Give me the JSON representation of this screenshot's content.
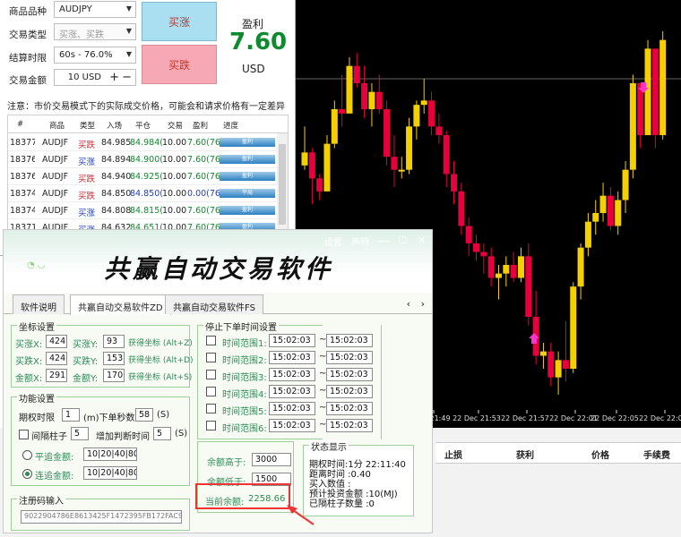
{
  "trade_panel": {
    "symbol_label": "商品品种",
    "symbol_value": "AUDJPY",
    "type_label": "交易类型",
    "type_value": "买涨、买跌",
    "expiry_label": "结算时限",
    "expiry_value": "60s - 76.0%",
    "amount_label": "交易金额",
    "amount_value": "10 USD",
    "buy_up_label": "买涨",
    "buy_down_label": "买跌",
    "profit_label": "盈利",
    "profit_value": "7.60",
    "profit_unit": "USD",
    "notice": "注意：市价交易模式下的实际成交价格，可能会和请求价格有一定差异",
    "table_headers": [
      "#",
      "商品",
      "类型",
      "入场",
      "平仓",
      "交易",
      "盈利",
      "进度"
    ],
    "rows": [
      {
        "id": "18377",
        "sym": "AUDJF",
        "type": "买跌",
        "entry": "84.985",
        "close": "84.984(",
        "amt": "10.00",
        "profit": "7.60(76",
        "state": "盈利",
        "type_color": "#d0262f",
        "close_color": "#0e8a2f",
        "profit_color": "#0e8a2f"
      },
      {
        "id": "18376",
        "sym": "AUDJF",
        "type": "买涨",
        "entry": "84.894",
        "close": "84.900(",
        "amt": "10.00",
        "profit": "7.60(76",
        "state": "盈利",
        "type_color": "#1f3fbf",
        "close_color": "#0e8a2f",
        "profit_color": "#0e8a2f"
      },
      {
        "id": "18376",
        "sym": "AUDJF",
        "type": "买跌",
        "entry": "84.940",
        "close": "84.925(",
        "amt": "10.00",
        "profit": "7.60(76",
        "state": "盈利",
        "type_color": "#d0262f",
        "close_color": "#0e8a2f",
        "profit_color": "#0e8a2f"
      },
      {
        "id": "18374",
        "sym": "AUDJF",
        "type": "买跌",
        "entry": "84.850",
        "close": "84.850(",
        "amt": "10.00",
        "profit": "0.00(76",
        "state": "平局",
        "type_color": "#d0262f",
        "close_color": "#1f3fbf",
        "profit_color": "#1f3fbf"
      },
      {
        "id": "18374",
        "sym": "AUDJF",
        "type": "买涨",
        "entry": "84.808",
        "close": "84.815(",
        "amt": "10.00",
        "profit": "7.60(76",
        "state": "盈利",
        "type_color": "#1f3fbf",
        "close_color": "#0e8a2f",
        "profit_color": "#0e8a2f"
      },
      {
        "id": "18371",
        "sym": "AUDJF",
        "type": "买涨",
        "entry": "84.632",
        "close": "84.651(",
        "amt": "10.00",
        "profit": "7.60(76",
        "state": "盈利",
        "type_color": "#1f3fbf",
        "close_color": "#0e8a2f",
        "profit_color": "#0e8a2f"
      },
      {
        "id": "18370",
        "sym": "AUDJF",
        "type": "买涨",
        "entry": "84.666",
        "close": "84.687(",
        "amt": "20.00",
        "profit": "15.20(7",
        "state": "盈利",
        "type_color": "#1f3fbf",
        "close_color": "#0e8a2f",
        "profit_color": "#0e8a2f"
      }
    ]
  },
  "auto": {
    "title_links": [
      "设置",
      "声明"
    ],
    "banner": "共赢自动交易软件",
    "tabs": [
      "软件说明",
      "共赢自动交易软件ZD",
      "共赢自动交易软件FS"
    ],
    "coord_group": "坐标设置",
    "coord_rows": [
      {
        "xlabel": "买涨X:",
        "x": "424",
        "ylabel": "买涨Y:",
        "y": "93",
        "hint": "获得坐标 (Alt+Z)"
      },
      {
        "xlabel": "买跌X:",
        "x": "424",
        "ylabel": "买跌Y:",
        "y": "153",
        "hint": "获得坐标 (Alt+D)"
      },
      {
        "xlabel": "金额X:",
        "x": "291",
        "ylabel": "金额Y:",
        "y": "170",
        "hint": "获得坐标 (Alt+S)"
      }
    ],
    "func_group": "功能设置",
    "period_label": "期权时限",
    "period_value": "1",
    "period_unit": "(m)下单秒数",
    "sec_value": "58",
    "sec_unit": "(S)",
    "gap_label": "间隔柱子",
    "gap_value": "5",
    "gap_label2": "增加判断时间",
    "gap_value2": "5",
    "gap_unit": "(S)",
    "flat_label": "平追金额:",
    "flat_value": "10|20|40|80",
    "cont_label": "连追金额:",
    "cont_value": "10|20|40|80",
    "reg_group": "注册码输入",
    "reg_code": "9022904786E8613425F1472395FB172FAC94A",
    "stop_group": "停止下单时间设置",
    "stop_rows": [
      {
        "label": "时间范围1:",
        "from": "15:02:03",
        "to": "15:02:03"
      },
      {
        "label": "时间范围2:",
        "from": "15:02:03",
        "to": "15:02:03"
      },
      {
        "label": "时间范围3:",
        "from": "15:02:03",
        "to": "15:02:03"
      },
      {
        "label": "时间范围4:",
        "from": "15:02:03",
        "to": "15:02:03"
      },
      {
        "label": "时间范围5:",
        "from": "15:02:03",
        "to": "15:02:03"
      },
      {
        "label": "时间范围6:",
        "from": "15:02:03",
        "to": "15:02:03"
      }
    ],
    "range_sep": "~",
    "high_label": "余额高于:",
    "high_value": "3000",
    "low_label": "余额低于:",
    "low_value": "1500",
    "cur_label": "当前余额:",
    "cur_value": "2258.66",
    "status_group": "状态显示",
    "status_lines": [
      "期权时间:1分 22:11:40",
      "距离时间 :0.40",
      "买入数值 :",
      "预计投资金额 :10(MJ)",
      "已隔柱子数量 :0"
    ]
  },
  "chart": {
    "time_labels": [
      "Dec 21:49",
      "22 Dec 21:53",
      "22 Dec 21:57",
      "22 Dec 22:01",
      "22 Dec 22:05",
      "22 Dec 22:09"
    ],
    "bottom_headers": [
      "止损",
      "获利",
      "价格",
      "手续费"
    ]
  },
  "chart_data": {
    "type": "candlestick",
    "candles": [
      [
        1,
        4,
        3,
        3.4
      ],
      [
        2,
        3.5,
        2.2,
        2.8
      ],
      [
        3,
        2.9,
        2.3,
        2.5
      ],
      [
        4,
        3.8,
        2.5,
        3.6
      ],
      [
        5,
        4.6,
        3.5,
        4.4
      ],
      [
        6,
        5.2,
        4.0,
        4.3
      ],
      [
        7,
        5.6,
        4.5,
        5.4
      ],
      [
        8,
        5.7,
        4.9,
        5.0
      ],
      [
        9,
        5.4,
        4.2,
        4.4
      ],
      [
        10,
        5.0,
        4.0,
        4.8
      ],
      [
        11,
        5.2,
        4.3,
        4.4
      ],
      [
        12,
        4.6,
        3.1,
        3.3
      ],
      [
        13,
        3.8,
        2.6,
        3.0
      ],
      [
        14,
        3.3,
        2.8,
        3.0
      ],
      [
        15,
        4.2,
        2.9,
        4.0
      ],
      [
        16,
        4.6,
        3.7,
        4.5
      ],
      [
        17,
        5.1,
        4.3,
        4.6
      ],
      [
        18,
        4.8,
        3.8,
        4.0
      ],
      [
        19,
        4.3,
        3.6,
        3.8
      ],
      [
        20,
        3.9,
        2.6,
        2.9
      ],
      [
        21,
        3.2,
        2.2,
        2.5
      ],
      [
        22,
        2.7,
        1.5,
        1.7
      ],
      [
        23,
        1.9,
        1.0,
        1.3
      ],
      [
        24,
        1.5,
        0.9,
        1.1
      ],
      [
        25,
        1.3,
        0.6,
        1.0
      ],
      [
        26,
        1.2,
        0.3,
        0.5
      ],
      [
        27,
        0.8,
        0.0,
        0.6
      ],
      [
        28,
        1.0,
        0.3,
        0.8
      ],
      [
        29,
        1.1,
        0.4,
        0.5
      ],
      [
        30,
        1.2,
        0.4,
        1.0
      ],
      [
        31,
        1.3,
        -0.6,
        -0.4
      ],
      [
        32,
        0.2,
        -1.5,
        -1.3
      ],
      [
        33,
        -1.0,
        -1.6,
        -1.2
      ],
      [
        34,
        -1.0,
        -2.0,
        -1.8
      ],
      [
        35,
        -1.2,
        -2.2,
        -1.4
      ],
      [
        36,
        -0.5,
        -1.9,
        -1.6
      ],
      [
        37,
        0.4,
        -1.7,
        0.3
      ],
      [
        38,
        1.3,
        0.0,
        1.2
      ],
      [
        39,
        2.0,
        1.0,
        1.8
      ],
      [
        40,
        2.3,
        1.5,
        2.0
      ],
      [
        41,
        2.7,
        1.8,
        2.4
      ],
      [
        42,
        2.6,
        1.6,
        1.7
      ],
      [
        43,
        2.5,
        1.5,
        2.3
      ],
      [
        44,
        3.2,
        2.0,
        3.0
      ],
      [
        45,
        5.2,
        2.8,
        5.0
      ],
      [
        46,
        4.2,
        3.5,
        3.8
      ],
      [
        47,
        6.0,
        3.8,
        5.8
      ],
      [
        48,
        4.0,
        3.5,
        3.8
      ],
      [
        49,
        6.2,
        3.7,
        6.0
      ]
    ]
  }
}
